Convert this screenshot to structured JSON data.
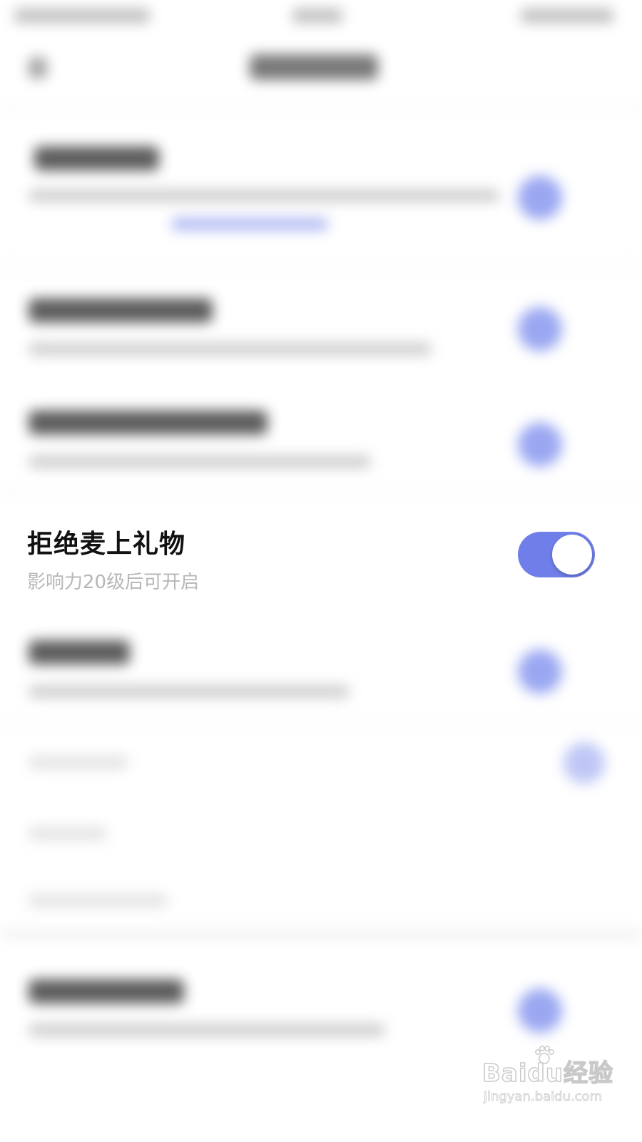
{
  "setting": {
    "title": "拒绝麦上礼物",
    "subtitle": "影响力20级后可开启",
    "toggle_on": true
  },
  "colors": {
    "accent": "#6f7ee8",
    "title": "#111111",
    "subtitle": "#b7b7b7",
    "background": "#ffffff"
  },
  "watermark": {
    "logo": "Baidu经验",
    "url": "jingyan.baidu.com"
  }
}
